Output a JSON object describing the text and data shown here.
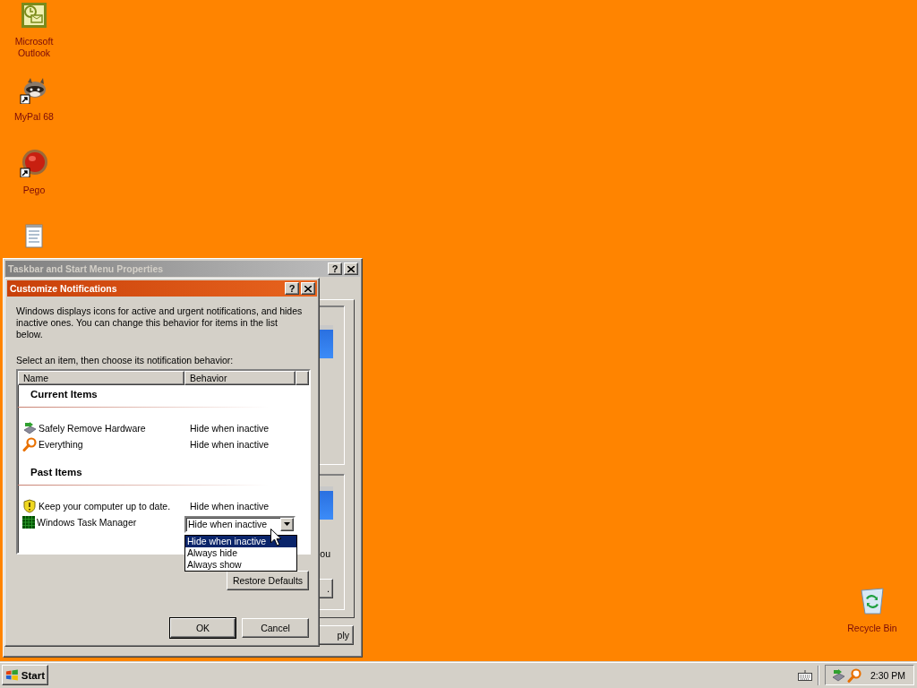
{
  "desktop_icons": [
    {
      "kind": "outlook",
      "label": "Microsoft Outlook",
      "shortcut": false
    },
    {
      "kind": "raccoon",
      "label": "MyPal 68",
      "shortcut": true
    },
    {
      "kind": "ball",
      "label": "Pego",
      "shortcut": true
    },
    {
      "kind": "notepad",
      "shortcut": false
    }
  ],
  "recycle_bin": {
    "label": "Recycle Bin"
  },
  "background_window": {
    "title": "Taskbar and Start Menu Properties",
    "active": false,
    "help": "?",
    "partial_text": "ou",
    "partial_button": ".",
    "partial_apply": "ply"
  },
  "dialog": {
    "title": "Customize Notifications",
    "active": true,
    "help": "?",
    "intro": "Windows displays icons for active and urgent notifications, and hides inactive ones. You can change this behavior for items in the list below.",
    "prompt": "Select an item, then choose its notification behavior:",
    "columns": [
      "Name",
      "Behavior"
    ],
    "groups": [
      {
        "title": "Current Items",
        "items": [
          {
            "kind": "hardware",
            "name": "Safely Remove Hardware",
            "behavior": "Hide when inactive",
            "editing": false
          },
          {
            "kind": "magnifier",
            "name": "Everything",
            "behavior": "Hide when inactive",
            "editing": false
          }
        ]
      },
      {
        "title": "Past Items",
        "items": [
          {
            "kind": "shield",
            "name": "Keep your computer up to date.",
            "behavior": "Hide when inactive",
            "editing": false
          },
          {
            "kind": "grid",
            "name": "Windows Task Manager",
            "behavior": "Hide when inactive",
            "editing": true,
            "options": [
              {
                "label": "Hide when inactive",
                "selected": true
              },
              {
                "label": "Always hide",
                "selected": false
              },
              {
                "label": "Always show",
                "selected": false
              }
            ]
          }
        ]
      }
    ],
    "restore_button": "Restore Defaults",
    "ok_button": "OK",
    "cancel_button": "Cancel"
  },
  "taskbar": {
    "start": "Start",
    "clock": "2:30 PM"
  }
}
